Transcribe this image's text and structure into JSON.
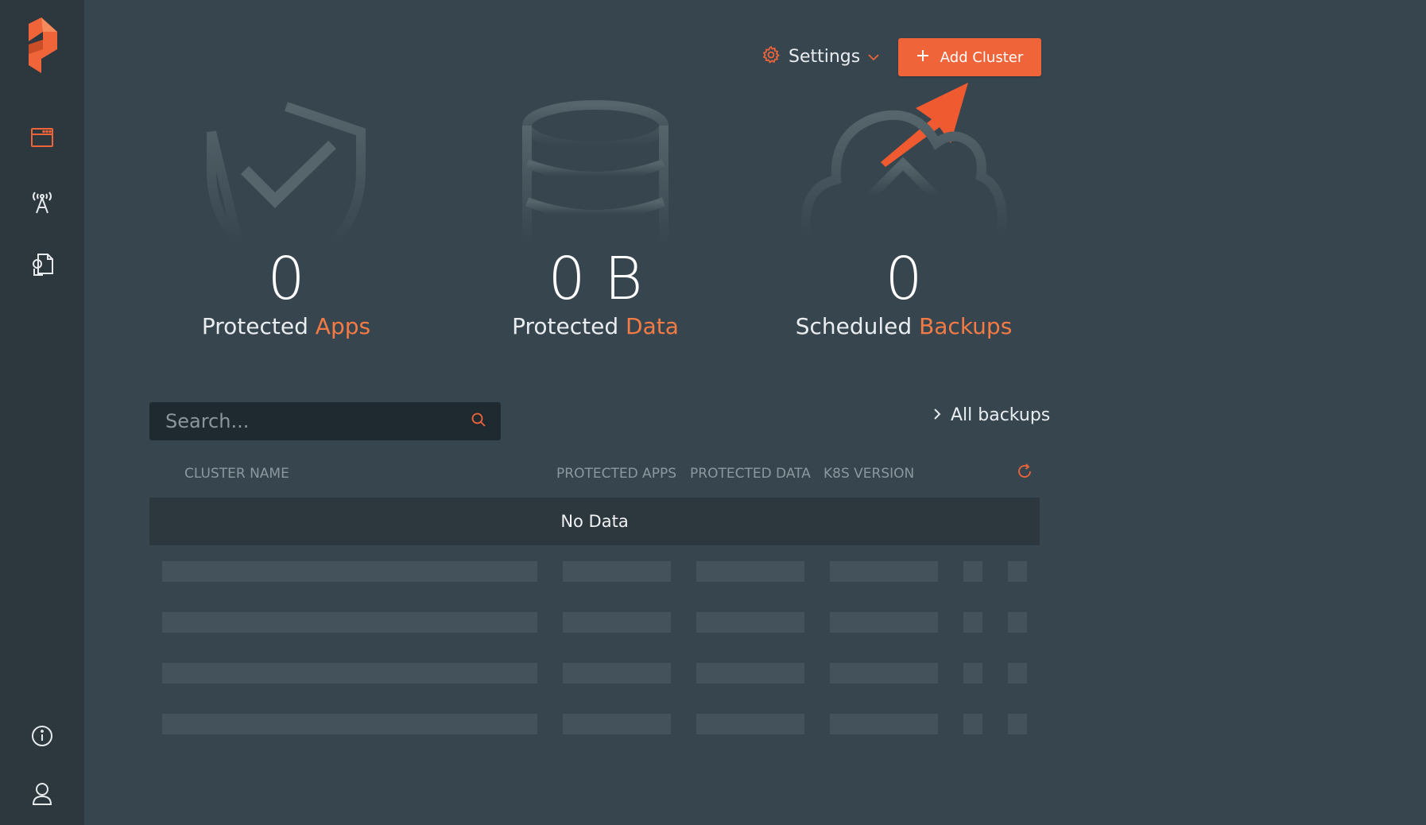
{
  "brand": {
    "accent": "#f0643a",
    "background": "#37454e",
    "sidebar": "#2c373e"
  },
  "sidebar": {
    "items": [
      {
        "icon": "portworx-logo"
      },
      {
        "icon": "applications-icon"
      },
      {
        "icon": "antenna-icon"
      },
      {
        "icon": "documents-icon"
      },
      {
        "icon": "info-icon"
      },
      {
        "icon": "user-icon"
      }
    ]
  },
  "header": {
    "settings_label": "Settings",
    "add_cluster_label": "Add Cluster"
  },
  "stats": [
    {
      "value": "0",
      "label_prefix": "Protected",
      "label_accent": "Apps",
      "icon": "shield-check-icon"
    },
    {
      "value": "0 B",
      "label_prefix": "Protected",
      "label_accent": "Data",
      "icon": "database-icon"
    },
    {
      "value": "0",
      "label_prefix": "Scheduled",
      "label_accent": "Backups",
      "icon": "cloud-upload-icon"
    }
  ],
  "search": {
    "placeholder": "Search..."
  },
  "all_backups_label": "All backups",
  "table": {
    "columns": [
      "CLUSTER NAME",
      "PROTECTED APPS",
      "PROTECTED DATA",
      "K8S VERSION"
    ],
    "empty_text": "No Data",
    "skeleton_rows": 4
  }
}
